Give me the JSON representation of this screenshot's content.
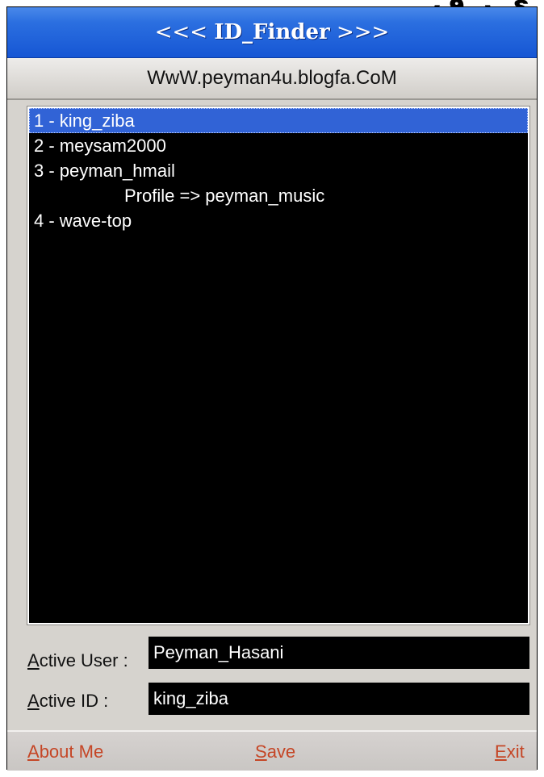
{
  "window": {
    "title_left": "<<< ",
    "title_name": "ID_Finder",
    "title_right": " >>>",
    "url": "WwW.peyman4u.blogfa.CoM"
  },
  "top_fragment": "ي ر ف",
  "list": {
    "items": [
      {
        "text": "1 - king_ziba",
        "selected": true,
        "indented": false
      },
      {
        "text": "2 - meysam2000",
        "selected": false,
        "indented": false
      },
      {
        "text": "3 - peyman_hmail",
        "selected": false,
        "indented": false
      },
      {
        "text": "Profile => peyman_music",
        "selected": false,
        "indented": true
      },
      {
        "text": "4 - wave-top",
        "selected": false,
        "indented": false
      }
    ]
  },
  "fields": {
    "active_user_label_key": "A",
    "active_user_label_rest": "ctive User :",
    "active_user_value": "Peyman_Hasani",
    "active_id_label_key": "A",
    "active_id_label_rest": "ctive ID :",
    "active_id_value": "king_ziba"
  },
  "footer": {
    "about_key": "A",
    "about_rest": "bout Me",
    "save_key": "S",
    "save_rest": "ave",
    "exit_key": "E",
    "exit_rest": "xit"
  },
  "colors": {
    "titlebar": "#1656d4",
    "selection": "#3163d6",
    "footer_text": "#c54626"
  }
}
